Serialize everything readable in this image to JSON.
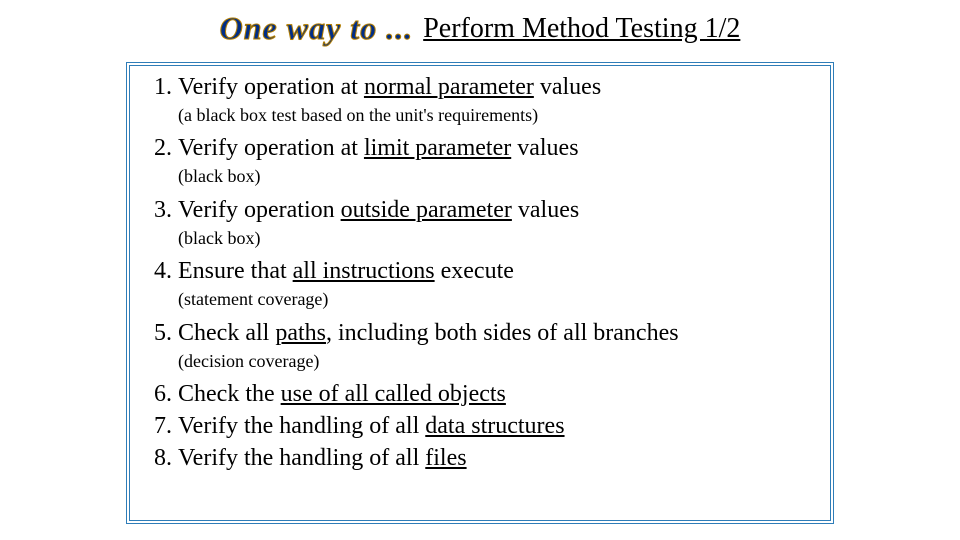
{
  "header": {
    "prefix": "One way to ...",
    "title": "Perform Method Testing  1/2"
  },
  "list": {
    "i1": {
      "a": "Verify operation at ",
      "u": "normal parameter",
      "b": " values",
      "note": "(a black box test based on the unit's requirements)"
    },
    "i2": {
      "a": "Verify operation at ",
      "u": "limit parameter",
      "b": " values",
      "note": "(black box)"
    },
    "i3": {
      "a": "Verify operation ",
      "u": "outside parameter",
      "b": " values",
      "note": "(black box)"
    },
    "i4": {
      "a": "Ensure that ",
      "u": "all instructions",
      "b": " execute",
      "note": "(statement coverage)"
    },
    "i5": {
      "a": "Check all ",
      "u": "paths",
      "b": ", including both sides of all branches",
      "note": "(decision coverage)"
    },
    "i6": {
      "a": "Check the ",
      "u": "use of all called objects",
      "b": ""
    },
    "i7": {
      "a": "Verify the handling of all ",
      "u": "data structures",
      "b": ""
    },
    "i8": {
      "a": "Verify the handling of all ",
      "u": "files",
      "b": ""
    }
  }
}
